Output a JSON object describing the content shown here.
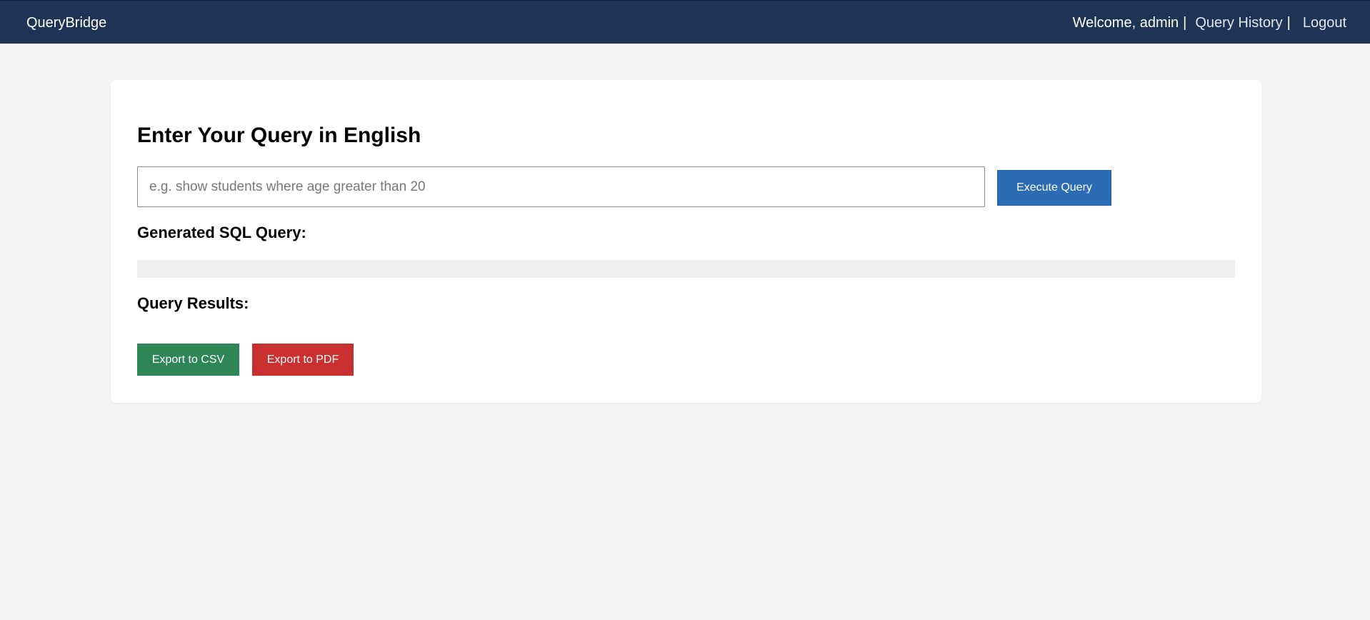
{
  "navbar": {
    "brand": "QueryBridge",
    "welcome": "Welcome, admin",
    "separator": "|",
    "history_link": "Query History",
    "logout_link": "Logout",
    "background_color": "#1f3354"
  },
  "main": {
    "heading": "Enter Your Query in English",
    "query_input": {
      "value": "",
      "placeholder": "e.g. show students where age greater than 20"
    },
    "execute_button": "Execute Query",
    "sql_section_title": "Generated SQL Query:",
    "sql_output": "",
    "results_section_title": "Query Results:",
    "export_csv_button": "Export to CSV",
    "export_pdf_button": "Export to PDF"
  },
  "colors": {
    "execute_button": "#2b6cb5",
    "csv_button": "#2e8657",
    "pdf_button": "#c9302f",
    "page_background": "#f4f4f4"
  }
}
